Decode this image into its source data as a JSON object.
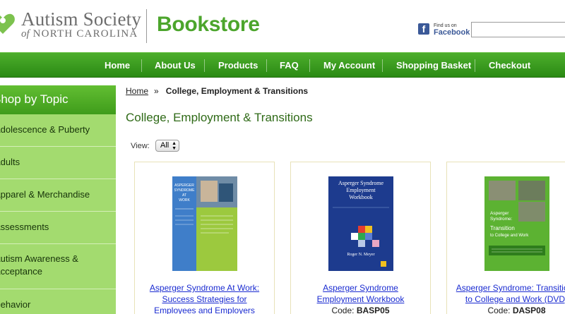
{
  "header": {
    "logo_line1": "Autism Society",
    "logo_line2_prefix": "of",
    "logo_line2_rest": "NORTH CAROLINA",
    "title": "Bookstore",
    "facebook_small": "Find us on",
    "facebook_big": "Facebook",
    "search_value": ""
  },
  "nav": [
    "Home",
    "About Us",
    "Products",
    "FAQ",
    "My Account",
    "Shopping Basket",
    "Checkout"
  ],
  "sidebar": {
    "heading": "Shop by Topic",
    "items": [
      {
        "line1": "Adolescence & Puberty",
        "line2": ""
      },
      {
        "line1": "Adults",
        "line2": ""
      },
      {
        "line1": "Apparel & Merchandise",
        "line2": ""
      },
      {
        "line1": "Assessments",
        "line2": ""
      },
      {
        "line1": "Autism Awareness &",
        "line2": "Acceptance"
      },
      {
        "line1": "Behavior",
        "line2": ""
      }
    ]
  },
  "breadcrumb": {
    "home": "Home",
    "separator": "»",
    "current": "College, Employment & Transitions"
  },
  "page_title": "College, Employment & Transitions",
  "view": {
    "label": "View:",
    "selected": "All"
  },
  "products": [
    {
      "link_lines": [
        "Asperger Syndrome At Work:",
        "Success Strategies for",
        "Employees and Employers"
      ],
      "code_label": "",
      "code": "",
      "cover": {
        "title_lines": [
          "ASPERGER",
          "SYNDROME",
          "AT",
          "WORK"
        ],
        "colors": [
          "#3f7ec9",
          "#9cc93e"
        ]
      }
    },
    {
      "link_lines": [
        "Asperger Syndrome",
        "Employment Workbook"
      ],
      "code_label": "Code:",
      "code": "BASP05",
      "cover": {
        "title_lines": [
          "Asperger Syndrome",
          "Employment",
          "Workbook"
        ],
        "author": "Roger N. Meyer",
        "colors": [
          "#1d3b8e",
          "#f0c020"
        ]
      }
    },
    {
      "link_lines": [
        "Asperger Syndrome: Transitions",
        "to College and Work (DVD)"
      ],
      "code_label": "Code:",
      "code": "DASP08",
      "cover": {
        "title_lines": [
          "Asperger",
          "Syndrome:",
          "Transition",
          "to College and Work"
        ],
        "colors": [
          "#5cb232",
          "#2e7d1c"
        ]
      }
    }
  ],
  "colors": {
    "brand_green": "#4ca52c",
    "sidebar_green": "#a3db6f",
    "link_blue": "#1a2bd1"
  }
}
